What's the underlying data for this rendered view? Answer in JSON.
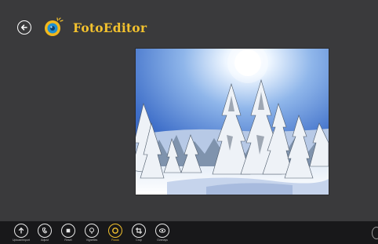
{
  "header": {
    "app_title": "FotoEditor",
    "back_icon": "arrow-left-icon",
    "logo_icon": "camera-lens-icon"
  },
  "photo": {
    "subject": "snowy-forest-winter-scene"
  },
  "app_bar": {
    "buttons": [
      {
        "label": "Upload/Import",
        "icon": "upload-icon"
      },
      {
        "label": "Adjust",
        "icon": "adjust-icon"
      },
      {
        "label": "Reset",
        "icon": "reset-icon"
      },
      {
        "label": "Vignettes",
        "icon": "vignette-icon"
      },
      {
        "label": "Focus",
        "icon": "focus-icon",
        "active": true
      },
      {
        "label": "Crop",
        "icon": "crop-icon"
      },
      {
        "label": "Overlays",
        "icon": "overlay-icon"
      }
    ],
    "more_icon": "more-icon"
  },
  "colors": {
    "background": "#3a3a3c",
    "app_bar": "#18181a",
    "accent": "#f2c12e"
  }
}
